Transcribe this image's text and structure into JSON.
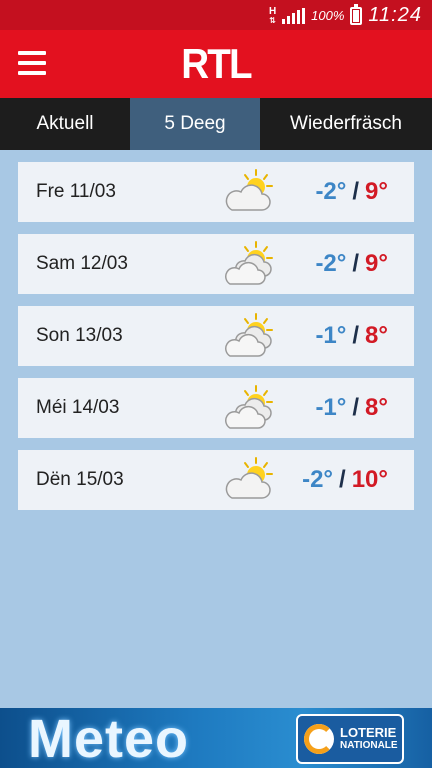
{
  "status_bar": {
    "network_letter": "H",
    "network_arrows": "⇅",
    "battery_percent": "100%",
    "time": "11:24"
  },
  "app_bar": {
    "logo": "RTL",
    "menu_icon": "hamburger-menu-icon"
  },
  "tabs": [
    {
      "label": "Aktuell",
      "selected": false
    },
    {
      "label": "5 Deeg",
      "selected": true
    },
    {
      "label": "Wiederfräsch",
      "selected": false
    }
  ],
  "forecast": [
    {
      "day": "Fre 11/03",
      "icon": "partly-cloudy-icon",
      "low": "-2°",
      "high": "9°"
    },
    {
      "day": "Sam 12/03",
      "icon": "cloudy-sun-icon",
      "low": "-2°",
      "high": "9°"
    },
    {
      "day": "Son 13/03",
      "icon": "cloudy-sun-icon",
      "low": "-1°",
      "high": "8°"
    },
    {
      "day": "Méi 14/03",
      "icon": "cloudy-sun-icon",
      "low": "-1°",
      "high": "8°"
    },
    {
      "day": "Dën 15/03",
      "icon": "partly-cloudy-icon",
      "low": "-2°",
      "high": "10°"
    }
  ],
  "separator": "/",
  "banner": {
    "title": "Meteo",
    "sponsor_line1": "LOTERIE",
    "sponsor_line2": "NATIONALE"
  },
  "colors": {
    "brand_red": "#e3111f",
    "low_temp": "#3d86c6",
    "high_temp": "#d21a25",
    "background": "#a8c8e4"
  }
}
